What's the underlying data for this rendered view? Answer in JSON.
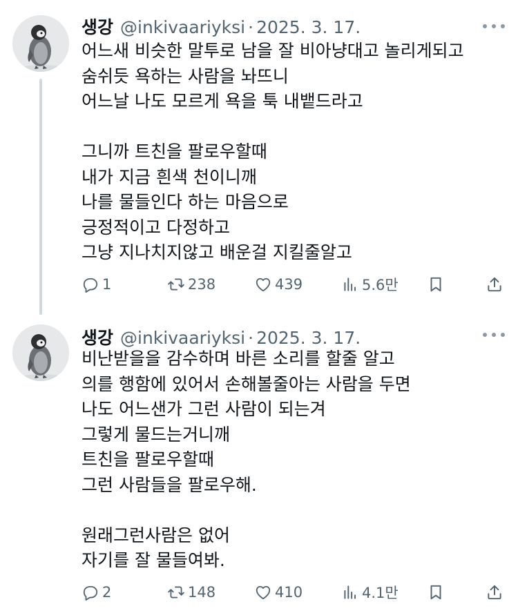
{
  "tweets": [
    {
      "author": {
        "display_name": "생강",
        "handle": "@inkivaariyksi",
        "separator": "·",
        "date": "2025. 3. 17."
      },
      "lines": [
        "어느새 비슷한 말투로 남을 잘 비아냥대고 놀리게되고",
        "숨쉬듯 욕하는 사람을 놔뜨니",
        "어느날 나도 모르게 욕을 툭 내뱉드라고",
        "",
        "그니까 트친을 팔로우할때",
        "내가 지금 흰색 천이니깨",
        "나를 물들인다 하는 마음으로",
        "긍정적이고 다정하고",
        "그냥 지나치지않고 배운걸 지킬줄알고"
      ],
      "stats": {
        "replies": "1",
        "reposts": "238",
        "likes": "439",
        "views": "5.6만"
      }
    },
    {
      "author": {
        "display_name": "생강",
        "handle": "@inkivaariyksi",
        "separator": "·",
        "date": "2025. 3. 17."
      },
      "lines": [
        "비난받을을 감수하며 바른 소리를 할줄 알고",
        "의를 행함에 있어서 손해볼줄아는 사람을 두면",
        "나도 어느샌가 그런 사람이 되는겨",
        "그렇게 물드는거니깨",
        "트친을 팔로우할때",
        "그런 사람들을 팔로우해.",
        "",
        "원래그런사람은 없어",
        "자기를 잘 물들여봐."
      ],
      "stats": {
        "replies": "2",
        "reposts": "148",
        "likes": "410",
        "views": "4.1만"
      }
    }
  ],
  "icons": {
    "more": "more-horizontal-icon",
    "reply": "reply-bubble-icon",
    "repost": "repost-arrows-icon",
    "like": "heart-icon",
    "views": "bar-chart-icon",
    "bookmark": "bookmark-icon",
    "share": "share-upload-icon"
  },
  "colors": {
    "text": "#0f1419",
    "secondary": "#536471",
    "thread_line": "#cfd9de"
  }
}
